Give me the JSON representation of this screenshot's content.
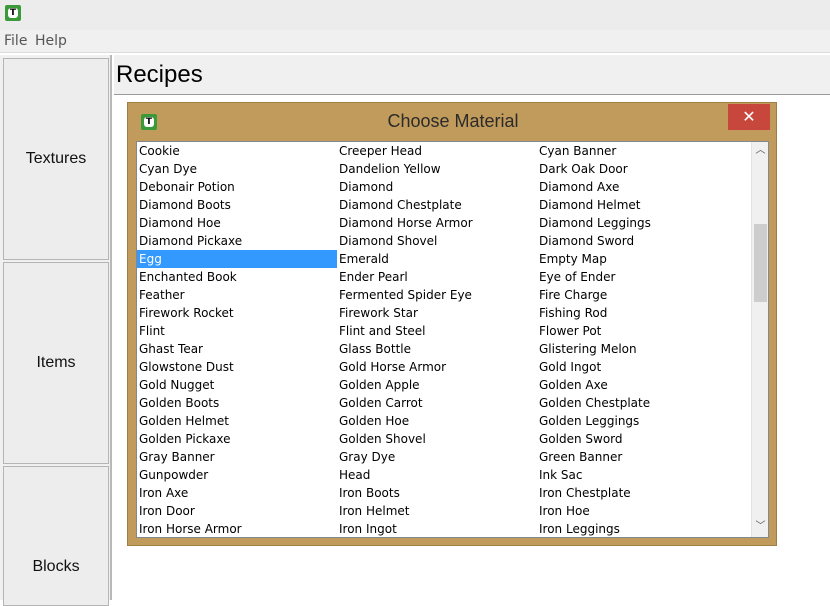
{
  "window": {
    "icon": "app-logo-icon"
  },
  "menu": {
    "file": "File",
    "help": "Help"
  },
  "sidebar": {
    "items": [
      {
        "label": "Textures"
      },
      {
        "label": "Items"
      },
      {
        "label": "Blocks"
      }
    ]
  },
  "main": {
    "title": "Recipes"
  },
  "dialog": {
    "title": "Choose Material",
    "close_glyph": "✕",
    "selected": "Egg",
    "rows": [
      [
        "Cookie",
        "Creeper Head",
        "Cyan Banner"
      ],
      [
        "Cyan Dye",
        "Dandelion Yellow",
        "Dark Oak Door"
      ],
      [
        "Debonair Potion",
        "Diamond",
        "Diamond Axe"
      ],
      [
        "Diamond Boots",
        "Diamond Chestplate",
        "Diamond Helmet"
      ],
      [
        "Diamond Hoe",
        "Diamond Horse Armor",
        "Diamond Leggings"
      ],
      [
        "Diamond Pickaxe",
        "Diamond Shovel",
        "Diamond Sword"
      ],
      [
        "Egg",
        "Emerald",
        "Empty Map"
      ],
      [
        "Enchanted Book",
        "Ender Pearl",
        "Eye of Ender"
      ],
      [
        "Feather",
        "Fermented Spider Eye",
        "Fire Charge"
      ],
      [
        "Firework Rocket",
        "Firework Star",
        "Fishing Rod"
      ],
      [
        "Flint",
        "Flint and Steel",
        "Flower Pot"
      ],
      [
        "Ghast Tear",
        "Glass Bottle",
        "Glistering Melon"
      ],
      [
        "Glowstone Dust",
        "Gold Horse Armor",
        "Gold Ingot"
      ],
      [
        "Gold Nugget",
        "Golden Apple",
        "Golden Axe"
      ],
      [
        "Golden Boots",
        "Golden Carrot",
        "Golden Chestplate"
      ],
      [
        "Golden Helmet",
        "Golden Hoe",
        "Golden Leggings"
      ],
      [
        "Golden Pickaxe",
        "Golden Shovel",
        "Golden Sword"
      ],
      [
        "Gray Banner",
        "Gray Dye",
        "Green Banner"
      ],
      [
        "Gunpowder",
        "Head",
        "Ink Sac"
      ],
      [
        "Iron Axe",
        "Iron Boots",
        "Iron Chestplate"
      ],
      [
        "Iron Door",
        "Iron Helmet",
        "Iron Hoe"
      ],
      [
        "Iron Horse Armor",
        "Iron Ingot",
        "Iron Leggings"
      ]
    ]
  },
  "colors": {
    "dialog_frame": "#c19b5b",
    "selection": "#3399ff",
    "close_button": "#c7473d"
  }
}
